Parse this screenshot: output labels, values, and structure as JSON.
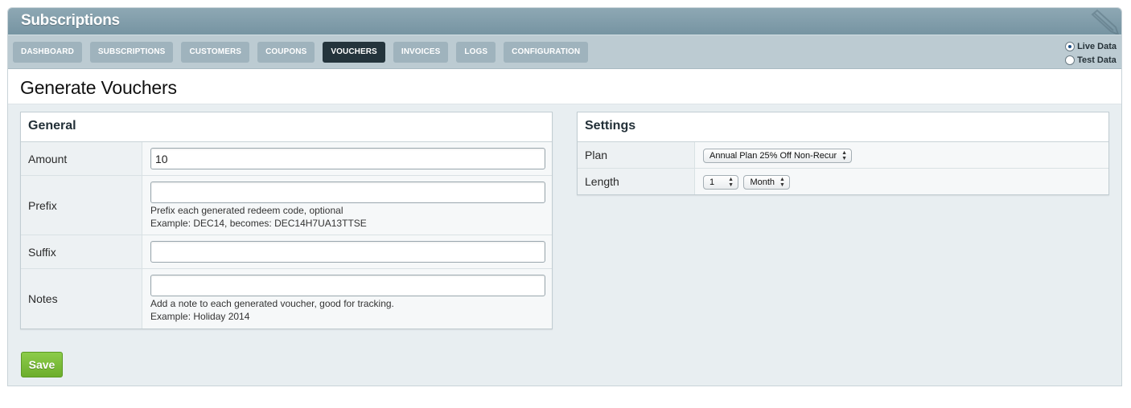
{
  "app": {
    "title": "Subscriptions"
  },
  "nav": {
    "tabs": [
      {
        "label": "DASHBOARD",
        "active": false
      },
      {
        "label": "SUBSCRIPTIONS",
        "active": false
      },
      {
        "label": "CUSTOMERS",
        "active": false
      },
      {
        "label": "COUPONS",
        "active": false
      },
      {
        "label": "VOUCHERS",
        "active": true
      },
      {
        "label": "INVOICES",
        "active": false
      },
      {
        "label": "LOGS",
        "active": false
      },
      {
        "label": "CONFIGURATION",
        "active": false
      }
    ],
    "data_mode": {
      "options": [
        {
          "label": "Live Data",
          "selected": true
        },
        {
          "label": "Test Data",
          "selected": false
        }
      ]
    }
  },
  "page": {
    "title": "Generate Vouchers"
  },
  "general": {
    "heading": "General",
    "amount": {
      "label": "Amount",
      "value": "10"
    },
    "prefix": {
      "label": "Prefix",
      "value": "",
      "help1": "Prefix each generated redeem code, optional",
      "help2": "Example: DEC14, becomes: DEC14H7UA13TTSE"
    },
    "suffix": {
      "label": "Suffix",
      "value": ""
    },
    "notes": {
      "label": "Notes",
      "value": "",
      "help1": "Add a note to each generated voucher, good for tracking.",
      "help2": "Example: Holiday 2014"
    }
  },
  "settings": {
    "heading": "Settings",
    "plan": {
      "label": "Plan",
      "selected": "Annual Plan 25% Off Non-Recur"
    },
    "length": {
      "label": "Length",
      "count": "1",
      "unit": "Month"
    }
  },
  "actions": {
    "save_label": "Save"
  },
  "colors": {
    "titlebar": "#7f9cab",
    "tab": "#9fb3bd",
    "tab_active": "#24343c",
    "save": "#7bbd3a"
  },
  "icons": {
    "brand": "pen-icon"
  }
}
